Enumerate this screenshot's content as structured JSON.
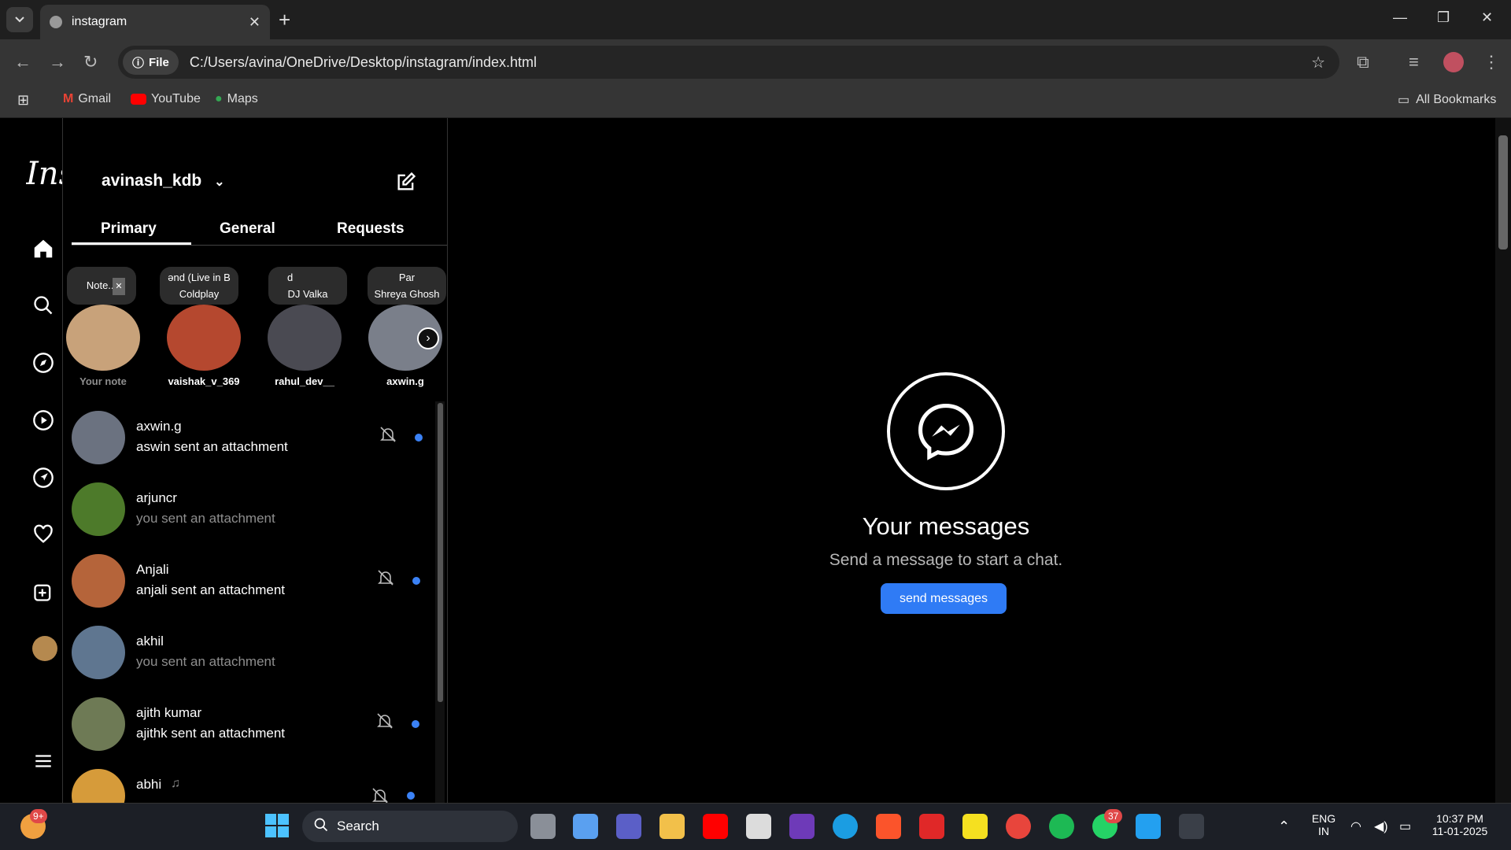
{
  "browser": {
    "tab_title": "instagram",
    "address_chip": "File",
    "url": "C:/Users/avina/OneDrive/Desktop/instagram/index.html",
    "bookmarks": [
      "Gmail",
      "YouTube",
      "Maps"
    ],
    "all_bookmarks": "All Bookmarks"
  },
  "app": {
    "logo_text": "Instagram",
    "username": "avinash_kdb",
    "tabs": [
      "Primary",
      "General",
      "Requests"
    ],
    "active_tab": "Primary"
  },
  "notes": [
    {
      "top": "Note...",
      "bottom": "",
      "name": "Your note",
      "avatar_color": "#c8a27a"
    },
    {
      "top": "ənd (Live in B",
      "bottom": "Coldplay",
      "name": "vaishak_v_369",
      "avatar_color": "#b5482f"
    },
    {
      "top": "d",
      "bottom": "DJ Valka",
      "name": "rahul_dev__",
      "avatar_color": "#4a4a52"
    },
    {
      "top": "Par",
      "bottom": "Shreya Ghosh",
      "name": "axwin.g",
      "avatar_color": "#7a7f8a"
    }
  ],
  "conversations": [
    {
      "name": "axwin.g",
      "message": "aswin sent an attachment",
      "unread": true,
      "muted": true,
      "avatar_color": "#6b7280"
    },
    {
      "name": "arjuncr",
      "message": "you sent an attachment",
      "unread": false,
      "muted": false,
      "avatar_color": "#4d7a2a"
    },
    {
      "name": "Anjali",
      "message": "anjali sent an attachment",
      "unread": true,
      "muted": true,
      "avatar_color": "#b5643a"
    },
    {
      "name": "akhil",
      "message": "you sent an attachment",
      "unread": false,
      "muted": false,
      "avatar_color": "#5f7690"
    },
    {
      "name": "ajith kumar",
      "message": "ajithk sent an attachment",
      "unread": true,
      "muted": true,
      "avatar_color": "#6e7a55"
    },
    {
      "name": "abhi",
      "message": "",
      "unread": true,
      "muted": true,
      "avatar_color": "#d69b3a"
    }
  ],
  "empty_state": {
    "title": "Your messages",
    "subtitle": "Send a message to start a chat.",
    "button": "send messages"
  },
  "taskbar": {
    "search_label": "Search",
    "weather_badge": "9+",
    "whatsapp_badge": "37",
    "lang": "ENG",
    "region": "IN",
    "time": "10:37 PM",
    "date": "11-01-2025"
  },
  "colors": {
    "accent_blue": "#2f7bf5",
    "unread_dot": "#3b82f6"
  }
}
